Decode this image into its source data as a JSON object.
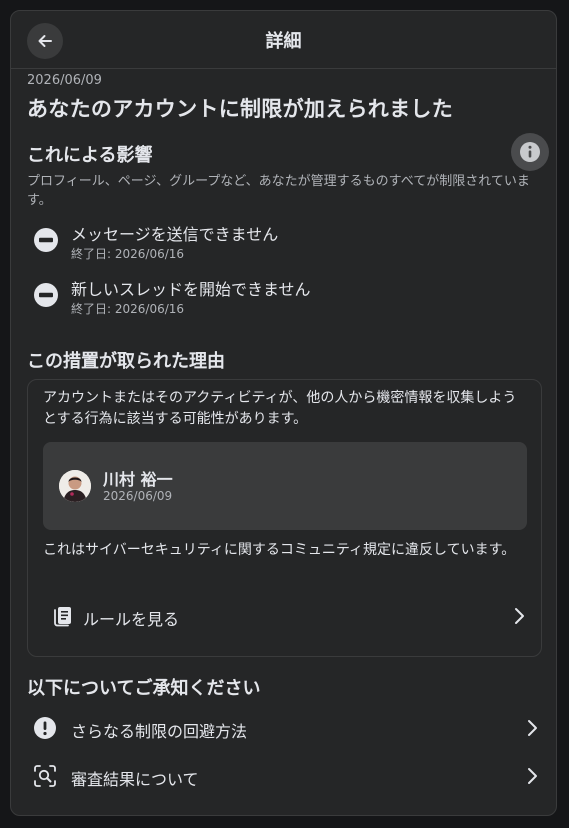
{
  "header": {
    "title": "詳細"
  },
  "notice": {
    "date": "2026/06/09",
    "title": "あなたのアカウントに制限が加えられました"
  },
  "impact": {
    "title": "これによる影響",
    "description": "プロフィール、ページ、グループなど、あなたが管理するものすべてが制限されています。",
    "items": [
      {
        "icon": "blocked-icon",
        "title": "メッセージを送信できません",
        "end": "終了日: 2026/06/16"
      },
      {
        "icon": "blocked-icon",
        "title": "新しいスレッドを開始できません",
        "end": "終了日: 2026/06/16"
      }
    ]
  },
  "reason": {
    "title": "この措置が取られた理由",
    "text": "アカウントまたはそのアクティビティが、他の人から機密情報を収集しようとする行為に該当する可能性があります。",
    "user": {
      "name": "川村 裕一",
      "date": "2026/06/09"
    },
    "violation": "これはサイバーセキュリティに関するコミュニティ規定に違反しています。",
    "rules_label": "ルールを見る"
  },
  "know": {
    "title": "以下についてご承知ください",
    "items": [
      {
        "icon": "exclamation-icon",
        "label": "さらなる制限の回避方法"
      },
      {
        "icon": "review-search-icon",
        "label": "審査結果について"
      }
    ]
  },
  "colors": {
    "background": "#252627",
    "card": "#3a3b3c",
    "text_primary": "#e4e6eb",
    "text_secondary": "#b0b3b8"
  }
}
